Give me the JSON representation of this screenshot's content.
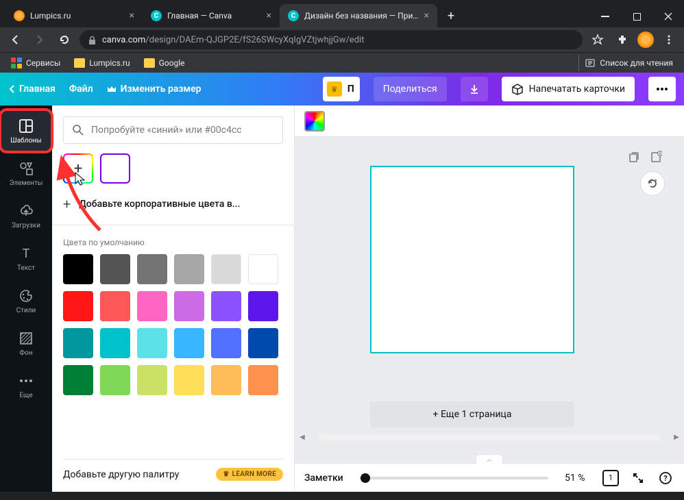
{
  "browser": {
    "tabs": [
      {
        "title": "Lumpics.ru",
        "icon_color": "#ff8800"
      },
      {
        "title": "Главная — Canva",
        "icon_color": "#00c4cc"
      },
      {
        "title": "Дизайн без названия — Пригл",
        "icon_color": "#00c4cc",
        "active": true
      }
    ],
    "url_domain": "canva.com",
    "url_path": "/design/DAEm-QJGP2E/fS26SWcyXqIgVZtjwhjjGw/edit",
    "bookmarks": {
      "services": "Сервисы",
      "lumpics": "Lumpics.ru",
      "google": "Google",
      "reading_list": "Список для чтения"
    }
  },
  "header": {
    "home": "Главная",
    "file": "Файл",
    "resize": "Изменить размер",
    "share": "Поделиться",
    "print": "Напечатать карточки",
    "try_char": "П"
  },
  "sidebar": {
    "templates": "Шаблоны",
    "elements": "Элементы",
    "uploads": "Загрузки",
    "text": "Текст",
    "styles": "Стили",
    "background": "Фон",
    "more": "Еще"
  },
  "panel": {
    "search_placeholder": "Попробуйте «синий» или #00c4cc",
    "add_corporate": "Добавьте корпоративные цвета в...",
    "default_colors": "Цвета по умолчанию",
    "add_palette": "Добавьте другую палитру",
    "learn_more": "LEARN MORE",
    "colors": [
      "#000000",
      "#545454",
      "#737373",
      "#a6a6a6",
      "#d9d9d9",
      "#ffffff",
      "#ff1616",
      "#ff5757",
      "#ff66c4",
      "#cb6ce6",
      "#8c52ff",
      "#5e17eb",
      "#03989e",
      "#00c2cb",
      "#5ce1e6",
      "#38b6ff",
      "#5271ff",
      "#004aad",
      "#008037",
      "#7ed957",
      "#c9e265",
      "#ffde59",
      "#ffbd59",
      "#ff914d"
    ]
  },
  "canvas": {
    "add_page": "+ Еще 1 страница",
    "notes": "Заметки",
    "zoom": "51 %",
    "page_num": "1"
  }
}
